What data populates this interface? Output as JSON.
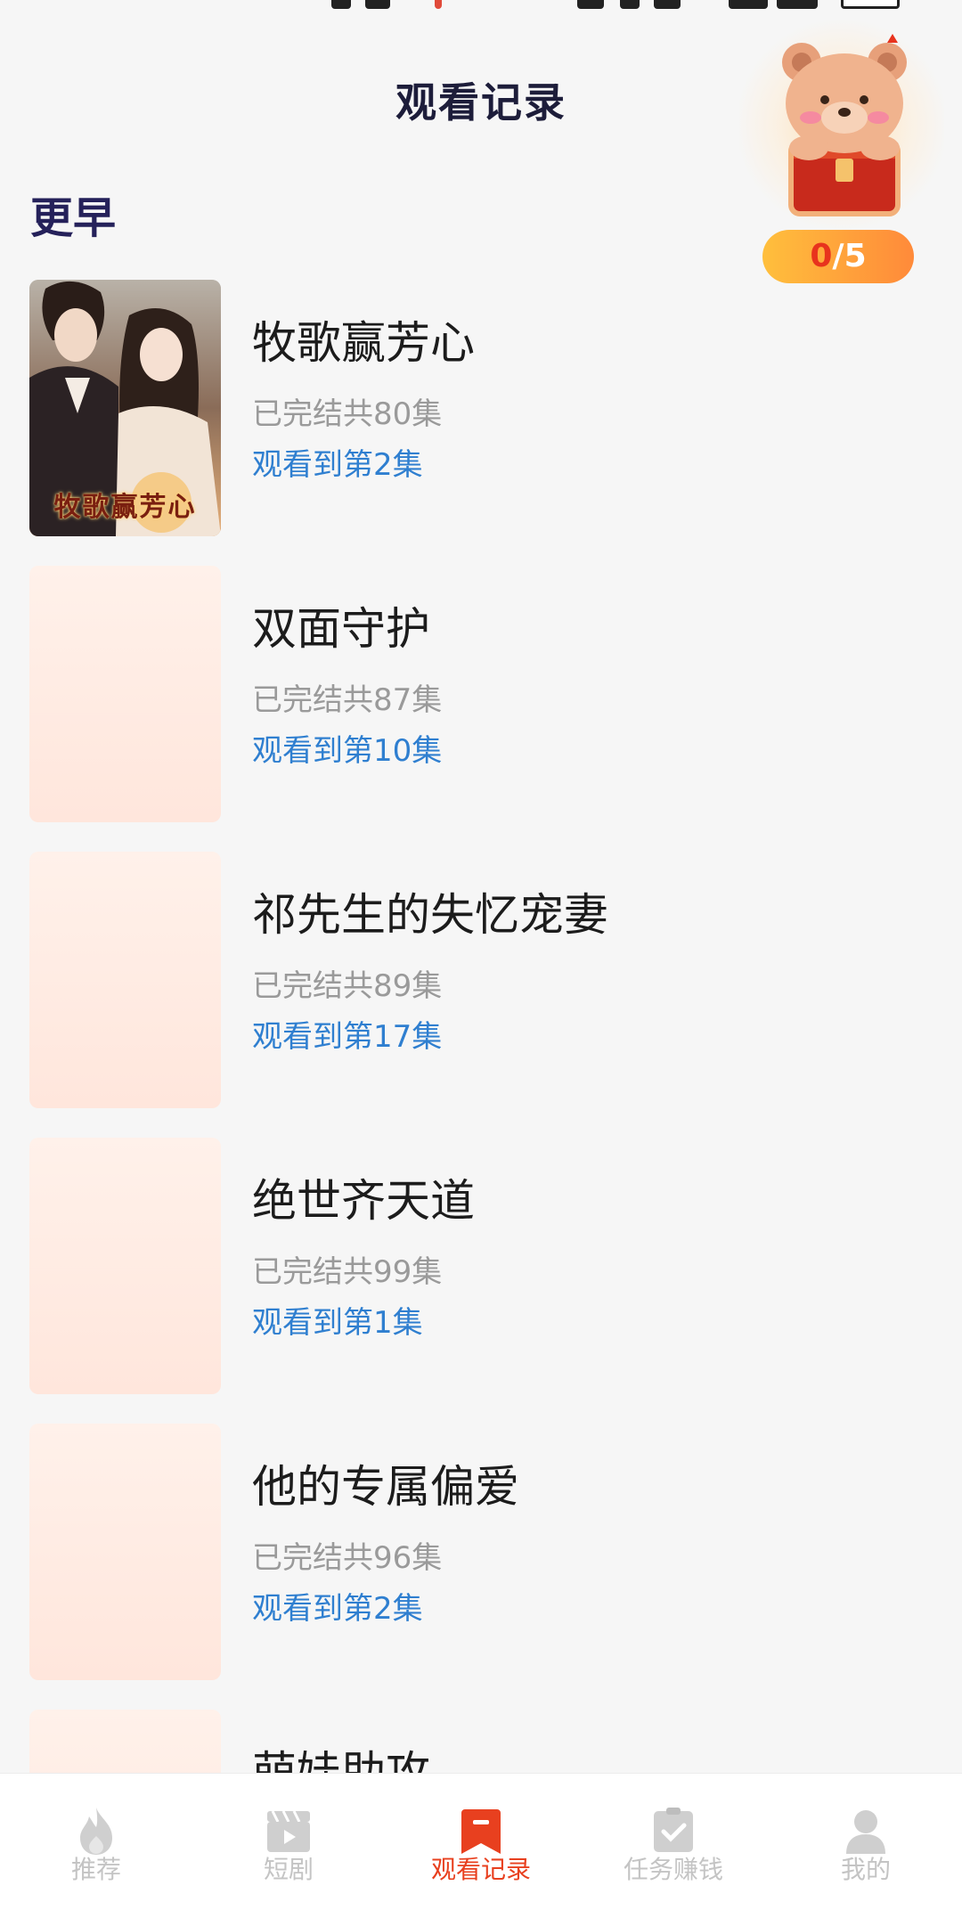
{
  "header": {
    "title": "观看记录"
  },
  "section": {
    "title": "更早"
  },
  "reward": {
    "progress_current": "0",
    "progress_separator": "/",
    "progress_total": "5"
  },
  "history": [
    {
      "title": "牧歌赢芳心",
      "status": "已完结共80集",
      "progress": "观看到第2集",
      "cover_text": "牧歌赢芳心"
    },
    {
      "title": "双面守护",
      "status": "已完结共87集",
      "progress": "观看到第10集"
    },
    {
      "title": "祁先生的失忆宠妻",
      "status": "已完结共89集",
      "progress": "观看到第17集"
    },
    {
      "title": "绝世齐天道",
      "status": "已完结共99集",
      "progress": "观看到第1集"
    },
    {
      "title": "他的专属偏爱",
      "status": "已完结共96集",
      "progress": "观看到第2集"
    },
    {
      "title": "萌娃助攻"
    }
  ],
  "tabbar": {
    "tabs": [
      {
        "label": "推荐",
        "icon": "flame-icon"
      },
      {
        "label": "短剧",
        "icon": "clapperboard-icon"
      },
      {
        "label": "观看记录",
        "icon": "bookmark-icon",
        "active": true
      },
      {
        "label": "任务赚钱",
        "icon": "task-check-icon"
      },
      {
        "label": "我的",
        "icon": "user-icon"
      }
    ]
  },
  "colors": {
    "accent": "#e8401f",
    "progress_text": "#2f7fd0",
    "meta_text": "#9a9a9a",
    "section_title": "#25215a",
    "reward_pill_start": "#ffbf3c",
    "reward_pill_end": "#ff8a3a"
  }
}
